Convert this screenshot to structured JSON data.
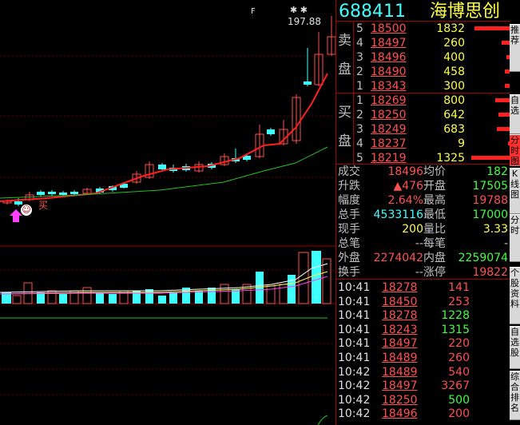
{
  "stock": {
    "code": "688411",
    "name": "海博思创"
  },
  "chart": {
    "price_label": "197.88",
    "stars": "✱ ✱",
    "marker_char": "F",
    "buy_signal_label": "买",
    "smile_icon": "smile-icon",
    "arrow_icon": "up-arrow-icon"
  },
  "orderbook": {
    "sell_label_1": "卖",
    "sell_label_2": "盘",
    "buy_label_1": "买",
    "buy_label_2": "盘",
    "sell": [
      {
        "level": "5",
        "price": "18500",
        "volume": "1832"
      },
      {
        "level": "4",
        "price": "18497",
        "volume": "260"
      },
      {
        "level": "3",
        "price": "18496",
        "volume": "400"
      },
      {
        "level": "2",
        "price": "18490",
        "volume": "458"
      },
      {
        "level": "1",
        "price": "18343",
        "volume": "300"
      }
    ],
    "buy": [
      {
        "level": "1",
        "price": "18269",
        "volume": "800"
      },
      {
        "level": "2",
        "price": "18250",
        "volume": "642"
      },
      {
        "level": "3",
        "price": "18249",
        "volume": "683"
      },
      {
        "level": "4",
        "price": "18237",
        "volume": "9"
      },
      {
        "level": "5",
        "price": "18219",
        "volume": "1325"
      }
    ]
  },
  "quote": {
    "rows": [
      {
        "l1": "成交",
        "v1": "18496",
        "l2": "均价",
        "v2": "182"
      },
      {
        "l1": "升跌",
        "v1": "▲476",
        "l2": "开盘",
        "v2": "17505"
      },
      {
        "l1": "幅度",
        "v1": "2.64%",
        "l2": "最高",
        "v2": "19788"
      },
      {
        "l1": "总手",
        "v1": "4533116",
        "l2": "最低",
        "v2": "17000"
      },
      {
        "l1": "现手",
        "v1": "200",
        "l2": "量比",
        "v2": "3.33"
      },
      {
        "l1": "总笔",
        "v1": "--",
        "l2": "每笔",
        "v2": "-"
      },
      {
        "l1": "外盘",
        "v1": "2274042",
        "l2": "内盘",
        "v2": "2259074"
      },
      {
        "l1": "换手",
        "v1": "--",
        "l2": "涨停",
        "v2": "19822"
      }
    ]
  },
  "ticks": [
    {
      "time": "10:41",
      "price": "18278",
      "vol": "141",
      "color": "red"
    },
    {
      "time": "10:41",
      "price": "18450",
      "vol": "253",
      "color": "red"
    },
    {
      "time": "10:41",
      "price": "18278",
      "vol": "1228",
      "color": "grn"
    },
    {
      "time": "10:41",
      "price": "18243",
      "vol": "1315",
      "color": "grn"
    },
    {
      "time": "10:41",
      "price": "18497",
      "vol": "220",
      "color": "red"
    },
    {
      "time": "10:41",
      "price": "18489",
      "vol": "260",
      "color": "red"
    },
    {
      "time": "10:42",
      "price": "18489",
      "vol": "540",
      "color": "red"
    },
    {
      "time": "10:42",
      "price": "18497",
      "vol": "3267",
      "color": "red"
    },
    {
      "time": "10:42",
      "price": "18250",
      "vol": "500",
      "color": "grn"
    },
    {
      "time": "10:42",
      "price": "18496",
      "vol": "200",
      "color": "red"
    }
  ],
  "sidetabs": [
    "推荐",
    "自选",
    "分时图",
    "K线图",
    "分时",
    "个股资料",
    "自选股",
    "综合排名"
  ],
  "colors": {
    "up": "#ff5050",
    "down": "#40ffff",
    "grid": "#a00000",
    "ma": "#ff2020",
    "ma2": "#20c020"
  }
}
